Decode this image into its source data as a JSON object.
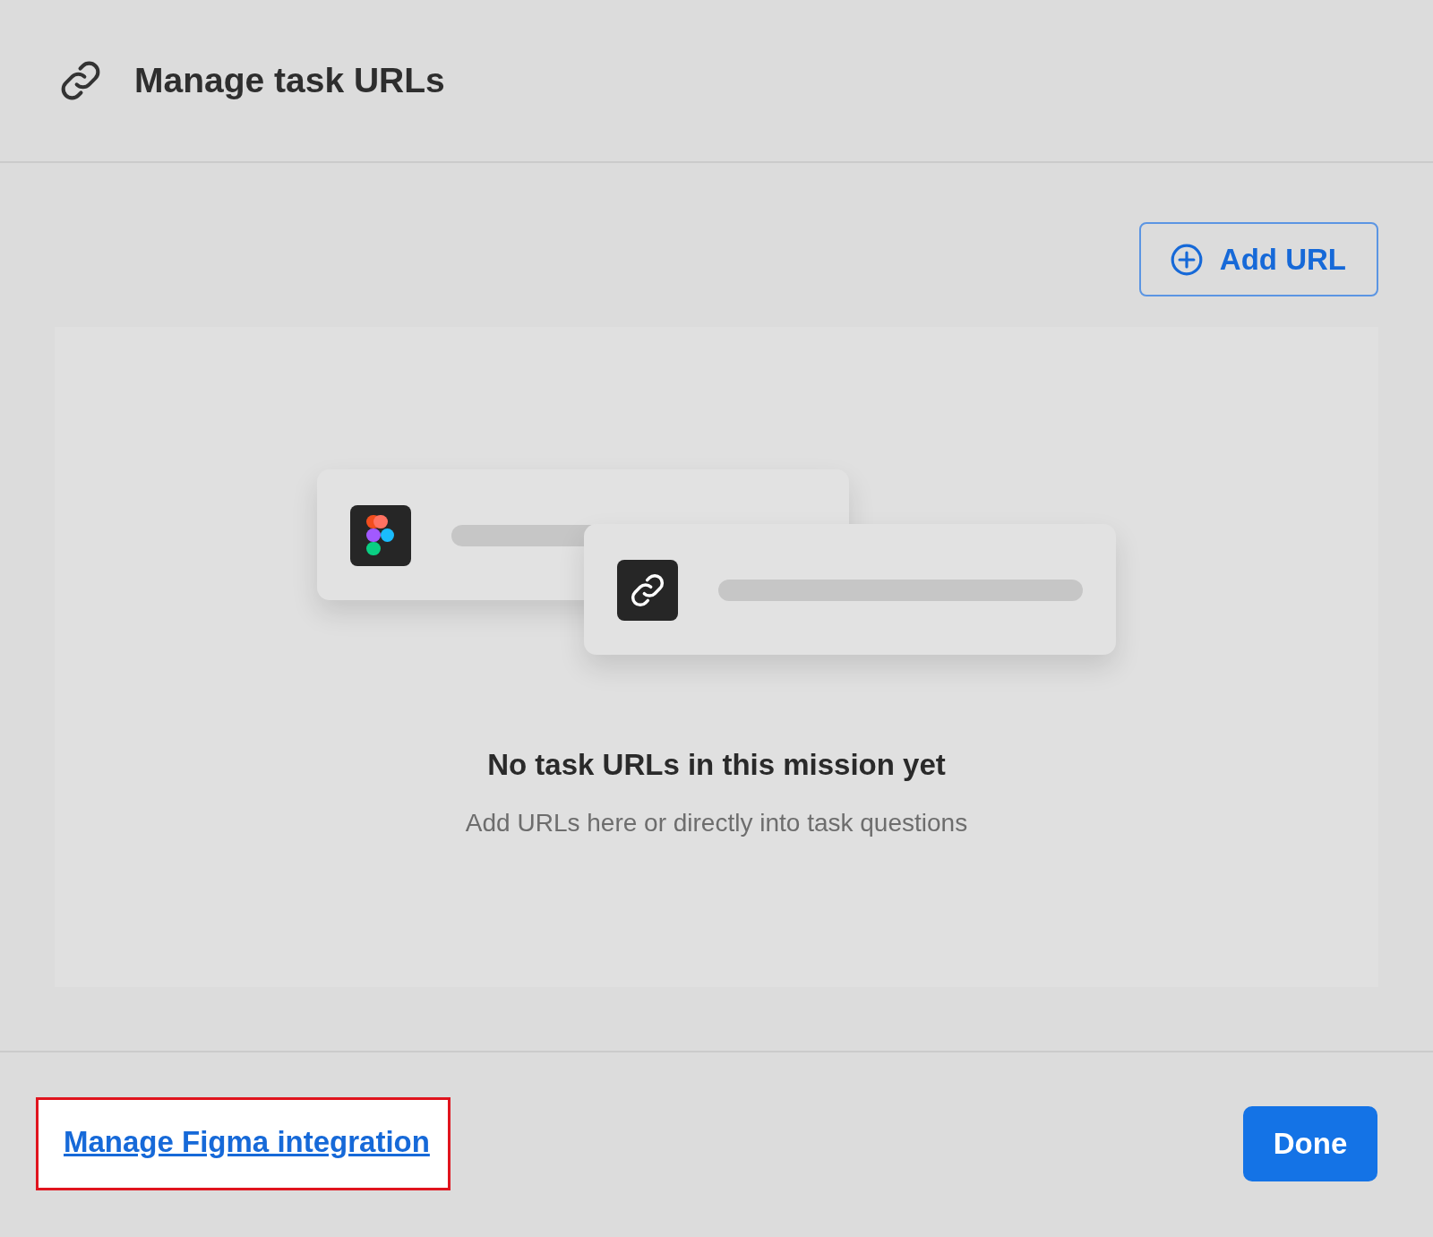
{
  "header": {
    "title": "Manage task URLs"
  },
  "toolbar": {
    "add_button": "Add URL"
  },
  "empty_state": {
    "title": "No task URLs in this mission yet",
    "subtitle": "Add URLs here or directly into task questions"
  },
  "footer": {
    "link": {
      "label": "Manage Figma integration",
      "highlighted": true
    },
    "done_button": "Done"
  }
}
